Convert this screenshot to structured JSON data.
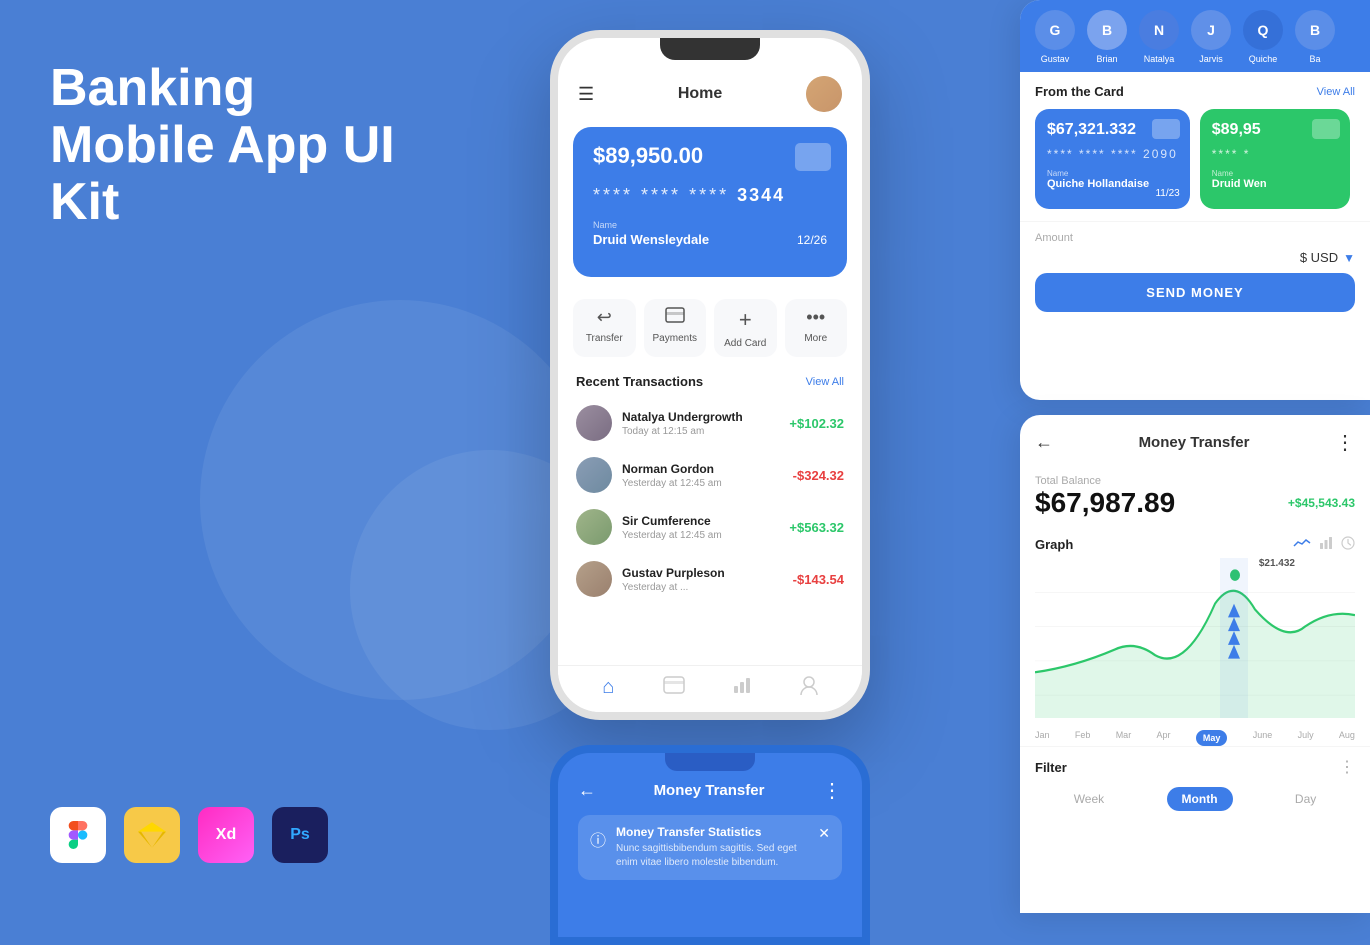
{
  "background_color": "#4a7fd4",
  "left": {
    "title_line1": "Banking",
    "title_line2": "Mobile App UI Kit"
  },
  "tools": [
    {
      "name": "figma",
      "label": "Figma",
      "color": "#ffffff"
    },
    {
      "name": "sketch",
      "label": "Sketch",
      "color": "#f7c948"
    },
    {
      "name": "xd",
      "label": "XD",
      "color": "#ff2bc2"
    },
    {
      "name": "ps",
      "label": "Ps",
      "color": "#1a1f5e"
    }
  ],
  "phone": {
    "header": {
      "title": "Home"
    },
    "card": {
      "balance": "$89,950.00",
      "dots1": "****",
      "dots2": "****",
      "dots3": "****",
      "last_digits": "3344",
      "name_label": "Name",
      "name": "Druid Wensleydale",
      "expiry": "12/26"
    },
    "actions": [
      {
        "label": "Transfer",
        "icon": "↩"
      },
      {
        "label": "Payments",
        "icon": "⬜"
      },
      {
        "label": "Add Card",
        "icon": "+"
      },
      {
        "label": "More",
        "icon": "•••"
      }
    ],
    "recent_transactions": {
      "title": "Recent Transactions",
      "view_all": "View All",
      "items": [
        {
          "name": "Natalya Undergrowth",
          "time": "Today at 12:15 am",
          "amount": "+$102.32",
          "type": "positive",
          "avatar_class": "av1"
        },
        {
          "name": "Norman Gordon",
          "time": "Yesterday at 12:45 am",
          "amount": "-$324.32",
          "type": "negative",
          "avatar_class": "av2"
        },
        {
          "name": "Sir Cumference",
          "time": "Yesterday at 12:45 am",
          "amount": "+$563.32",
          "type": "positive",
          "avatar_class": "av3"
        },
        {
          "name": "Gustav Purpleson",
          "time": "Yesterday at ...",
          "amount": "-$143.54",
          "type": "negative",
          "avatar_class": "av4"
        }
      ]
    }
  },
  "right_top": {
    "recipients": [
      {
        "name": "Gustav",
        "initial": "G"
      },
      {
        "name": "Brian",
        "initial": "B"
      },
      {
        "name": "Natalya",
        "initial": "N"
      },
      {
        "name": "Jarvis",
        "initial": "J"
      },
      {
        "name": "Quiche",
        "initial": "Q"
      },
      {
        "name": "Ba",
        "initial": "B"
      }
    ],
    "from_card": {
      "title": "From the Card",
      "view_all": "View All",
      "cards": [
        {
          "balance": "$67,321.332",
          "dots": "**** **** **** 2090",
          "name_label": "Name",
          "name": "Quiche Hollandaise",
          "expiry": "11/23",
          "type": "blue"
        },
        {
          "balance": "$89,95",
          "dots": "**** *",
          "name_label": "Name",
          "name": "Druid Wen",
          "type": "green"
        }
      ]
    },
    "amount": {
      "label": "Amount",
      "value": "$ USD",
      "currency_icon": "▼"
    },
    "send_button": "SEND MONEY"
  },
  "right_bottom": {
    "title": "Money Transfer",
    "back_icon": "←",
    "more_icon": "⋮",
    "total_balance_label": "Total Balance",
    "total_balance": "$67,987.89",
    "balance_change": "+$45,543.43",
    "graph_label": "Graph",
    "chart_data": {
      "peak_label": "$21.432",
      "months": [
        "Jan",
        "Feb",
        "Mar",
        "Apr",
        "May",
        "June",
        "July",
        "Aug"
      ],
      "active_month": "May"
    },
    "filter": {
      "label": "Filter",
      "tabs": [
        "Week",
        "Month",
        "Day"
      ],
      "active": "Month"
    }
  },
  "bottom_phone": {
    "title": "Money Transfer",
    "back_icon": "←",
    "more_icon": "⋮",
    "notification": {
      "title": "Money Transfer Statistics",
      "text": "Nunc sagittisbibendum sagittis. Sed eget enim vitae libero molestie bibendum."
    }
  }
}
